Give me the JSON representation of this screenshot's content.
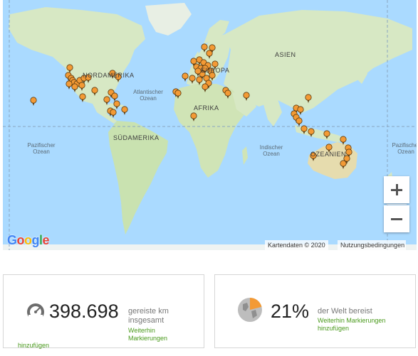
{
  "map": {
    "labels": {
      "north_america": "NORDAMERIKA",
      "south_america": "SÜDAMERIKA",
      "europe": "EUROPA",
      "africa": "AFRIKA",
      "asia": "ASIEN",
      "oceania": "OZEANIEN",
      "atlantic": "Atlantischer Ozean",
      "pacific_left": "Pazifischer Ozean",
      "pacific_right": "Pazifischer Ozean",
      "indian": "Indischer Ozean"
    },
    "zoom_in": "+",
    "zoom_out": "−",
    "attribution": "Kartendaten © 2020",
    "terms": "Nutzungsbedingungen",
    "logo": "Google",
    "colors": {
      "water": "#aadaff",
      "land": "#d7e8c4",
      "marker": "#f39a35"
    },
    "marker_icon": "map-pin-icon"
  },
  "stats": {
    "distance": {
      "icon": "speedometer-icon",
      "value": "398.698",
      "caption_line1": "gereiste km",
      "caption_line2": "insgesamt",
      "link_line1": "Weiterhin",
      "link_line2": "Markierungen",
      "link_line3": "hinzufügen"
    },
    "world": {
      "icon": "globe-pie-icon",
      "value": "21%",
      "progress": 0.21,
      "caption": "der Welt bereist",
      "link_line1": "Weiterhin Markierungen",
      "link_line2": "hinzufügen"
    }
  }
}
